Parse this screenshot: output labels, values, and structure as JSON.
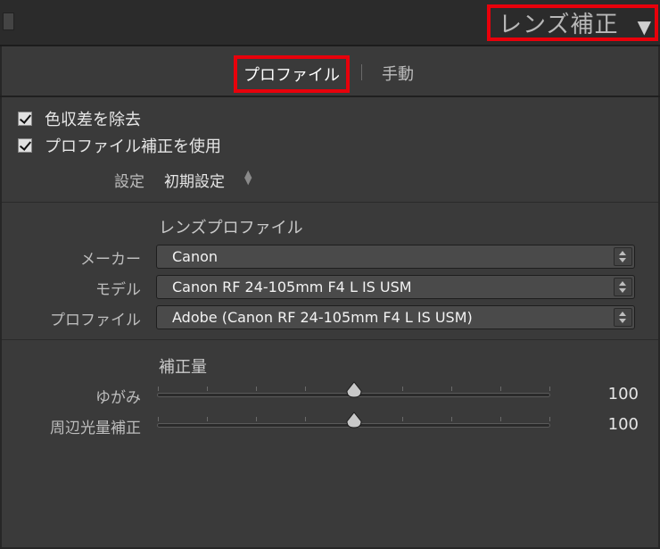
{
  "panel": {
    "title": "レンズ補正"
  },
  "tabs": [
    {
      "label": "プロファイル",
      "active": true
    },
    {
      "label": "手動",
      "active": false
    }
  ],
  "checkboxes": [
    {
      "label": "色収差を除去",
      "checked": true
    },
    {
      "label": "プロファイル補正を使用",
      "checked": true
    }
  ],
  "setup": {
    "label": "設定",
    "value": "初期設定"
  },
  "lens_profile": {
    "title": "レンズプロファイル",
    "make": {
      "label": "メーカー",
      "value": "Canon"
    },
    "model": {
      "label": "モデル",
      "value": "Canon RF 24-105mm F4 L IS USM"
    },
    "profile": {
      "label": "プロファイル",
      "value": "Adobe (Canon RF 24-105mm F4 L IS USM)"
    }
  },
  "amount": {
    "title": "補正量",
    "distortion": {
      "label": "ゆがみ",
      "value": "100",
      "level": 0.5
    },
    "vignetting": {
      "label": "周辺光量補正",
      "value": "100",
      "level": 0.5
    }
  },
  "colors": {
    "highlight": "#e8000b",
    "panel_bg": "#3a3a3a",
    "header_bg": "#2b2b2b"
  }
}
